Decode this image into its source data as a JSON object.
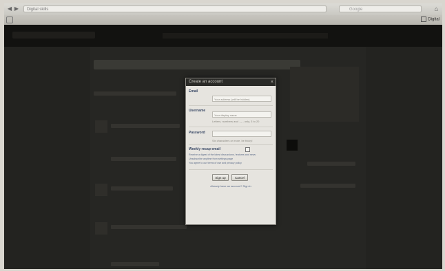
{
  "browser": {
    "tab_title": "Digital skills",
    "url": "",
    "search_placeholder": "Google",
    "bookmark_right": "Digital"
  },
  "modal": {
    "title": "Create an account",
    "close_glyph": "×",
    "email": {
      "label": "Email",
      "placeholder": "Your address (will be hidden)"
    },
    "username": {
      "label": "Username",
      "placeholder": "Your display name",
      "hint": "Letters, numbers and . _ - only, 3 to 20"
    },
    "password": {
      "label": "Password",
      "placeholder": "",
      "hint": "Six characters or more, be tricky!"
    },
    "verify": {
      "label": "Weekly recap email",
      "line1": "Receive a digest of the latest discussions, features and news",
      "line2": "Unsubscribe anytime from settings page",
      "line3": "You agree to our terms of use and privacy policy"
    },
    "buttons": {
      "signup": "Sign up",
      "cancel": "Cancel"
    },
    "footer_link": "Already have an account? Sign in"
  }
}
